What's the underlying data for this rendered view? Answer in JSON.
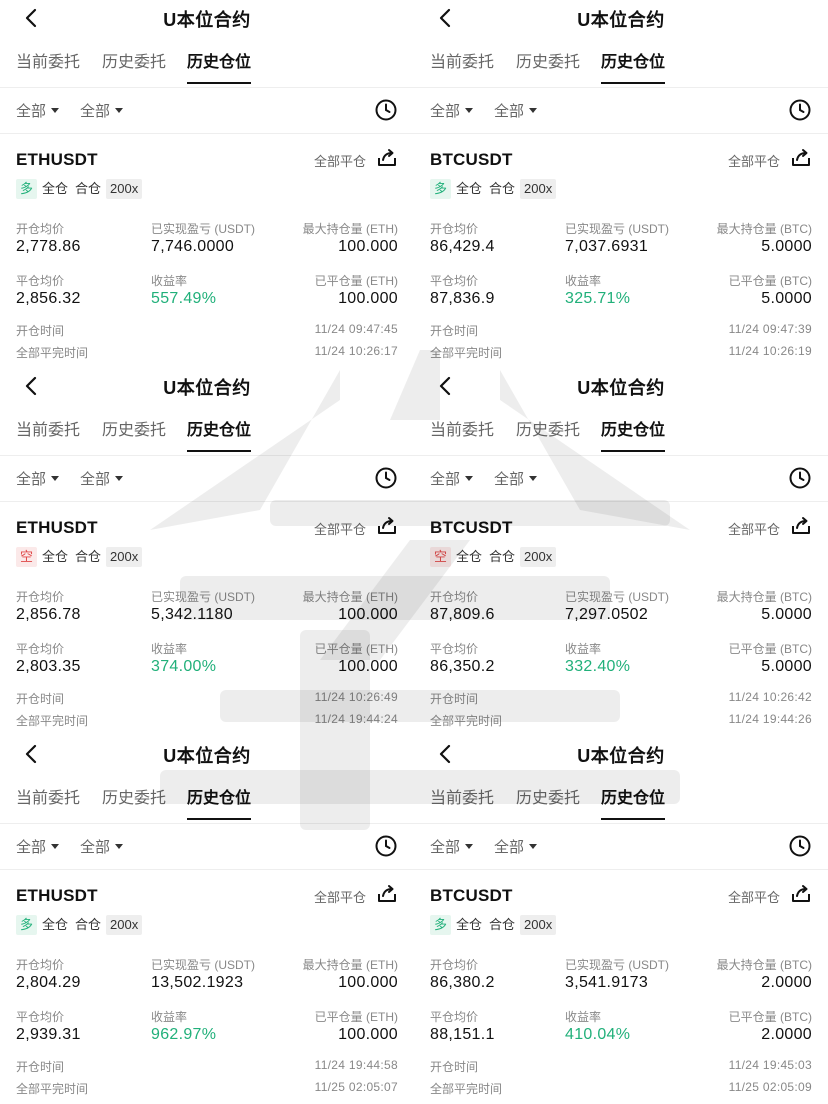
{
  "header": {
    "title": "U本位合约"
  },
  "tabs": [
    {
      "label": "当前委托"
    },
    {
      "label": "历史委托"
    },
    {
      "label": "历史仓位"
    }
  ],
  "filters": [
    {
      "label": "全部"
    },
    {
      "label": "全部"
    }
  ],
  "icons": {
    "back": "chevron-left-icon",
    "history": "clock-icon",
    "share": "share-icon"
  },
  "colors": {
    "long": "#21b07a",
    "short": "#e04a4a",
    "text": "#111111",
    "muted": "#888888"
  },
  "panels": [
    {
      "symbol": "ETHUSDT",
      "close_all": "全部平仓",
      "direction": "多",
      "margin_mode": "全仓",
      "position_mode": "合仓",
      "leverage": "200x",
      "labels": {
        "open_price": "开仓均价",
        "realized_pnl": "已实现盈亏 (USDT)",
        "max_position": "最大持仓量 (ETH)",
        "close_price": "平仓均价",
        "roi": "收益率",
        "closed_qty": "已平仓量 (ETH)",
        "open_time": "开仓时间",
        "close_time": "全部平完时间"
      },
      "open_price": "2,778.86",
      "realized_pnl": "7,746.0000",
      "max_position": "100.000",
      "close_price": "2,856.32",
      "roi": "557.49%",
      "closed_qty": "100.000",
      "open_time": "11/24 09:47:45",
      "close_time": "11/24 10:26:17"
    },
    {
      "symbol": "BTCUSDT",
      "close_all": "全部平仓",
      "direction": "多",
      "margin_mode": "全仓",
      "position_mode": "合仓",
      "leverage": "200x",
      "labels": {
        "open_price": "开仓均价",
        "realized_pnl": "已实现盈亏 (USDT)",
        "max_position": "最大持仓量 (BTC)",
        "close_price": "平仓均价",
        "roi": "收益率",
        "closed_qty": "已平仓量 (BTC)",
        "open_time": "开仓时间",
        "close_time": "全部平完时间"
      },
      "open_price": "86,429.4",
      "realized_pnl": "7,037.6931",
      "max_position": "5.0000",
      "close_price": "87,836.9",
      "roi": "325.71%",
      "closed_qty": "5.0000",
      "open_time": "11/24 09:47:39",
      "close_time": "11/24 10:26:19"
    },
    {
      "symbol": "ETHUSDT",
      "close_all": "全部平仓",
      "direction": "空",
      "margin_mode": "全仓",
      "position_mode": "合仓",
      "leverage": "200x",
      "labels": {
        "open_price": "开仓均价",
        "realized_pnl": "已实现盈亏 (USDT)",
        "max_position": "最大持仓量 (ETH)",
        "close_price": "平仓均价",
        "roi": "收益率",
        "closed_qty": "已平仓量 (ETH)",
        "open_time": "开仓时间",
        "close_time": "全部平完时间"
      },
      "open_price": "2,856.78",
      "realized_pnl": "5,342.1180",
      "max_position": "100.000",
      "close_price": "2,803.35",
      "roi": "374.00%",
      "closed_qty": "100.000",
      "open_time": "11/24 10:26:49",
      "close_time": "11/24 19:44:24"
    },
    {
      "symbol": "BTCUSDT",
      "close_all": "全部平仓",
      "direction": "空",
      "margin_mode": "全仓",
      "position_mode": "合仓",
      "leverage": "200x",
      "labels": {
        "open_price": "开仓均价",
        "realized_pnl": "已实现盈亏 (USDT)",
        "max_position": "最大持仓量 (BTC)",
        "close_price": "平仓均价",
        "roi": "收益率",
        "closed_qty": "已平仓量 (BTC)",
        "open_time": "开仓时间",
        "close_time": "全部平完时间"
      },
      "open_price": "87,809.6",
      "realized_pnl": "7,297.0502",
      "max_position": "5.0000",
      "close_price": "86,350.2",
      "roi": "332.40%",
      "closed_qty": "5.0000",
      "open_time": "11/24 10:26:42",
      "close_time": "11/24 19:44:26"
    },
    {
      "symbol": "ETHUSDT",
      "close_all": "全部平仓",
      "direction": "多",
      "margin_mode": "全仓",
      "position_mode": "合仓",
      "leverage": "200x",
      "labels": {
        "open_price": "开仓均价",
        "realized_pnl": "已实现盈亏 (USDT)",
        "max_position": "最大持仓量 (ETH)",
        "close_price": "平仓均价",
        "roi": "收益率",
        "closed_qty": "已平仓量 (ETH)",
        "open_time": "开仓时间",
        "close_time": "全部平完时间"
      },
      "open_price": "2,804.29",
      "realized_pnl": "13,502.1923",
      "max_position": "100.000",
      "close_price": "2,939.31",
      "roi": "962.97%",
      "closed_qty": "100.000",
      "open_time": "11/24 19:44:58",
      "close_time": "11/25 02:05:07"
    },
    {
      "symbol": "BTCUSDT",
      "close_all": "全部平仓",
      "direction": "多",
      "margin_mode": "全仓",
      "position_mode": "合仓",
      "leverage": "200x",
      "labels": {
        "open_price": "开仓均价",
        "realized_pnl": "已实现盈亏 (USDT)",
        "max_position": "最大持仓量 (BTC)",
        "close_price": "平仓均价",
        "roi": "收益率",
        "closed_qty": "已平仓量 (BTC)",
        "open_time": "开仓时间",
        "close_time": "全部平完时间"
      },
      "open_price": "86,380.2",
      "realized_pnl": "3,541.9173",
      "max_position": "2.0000",
      "close_price": "88,151.1",
      "roi": "410.04%",
      "closed_qty": "2.0000",
      "open_time": "11/24 19:45:03",
      "close_time": "11/25 02:05:09"
    }
  ]
}
